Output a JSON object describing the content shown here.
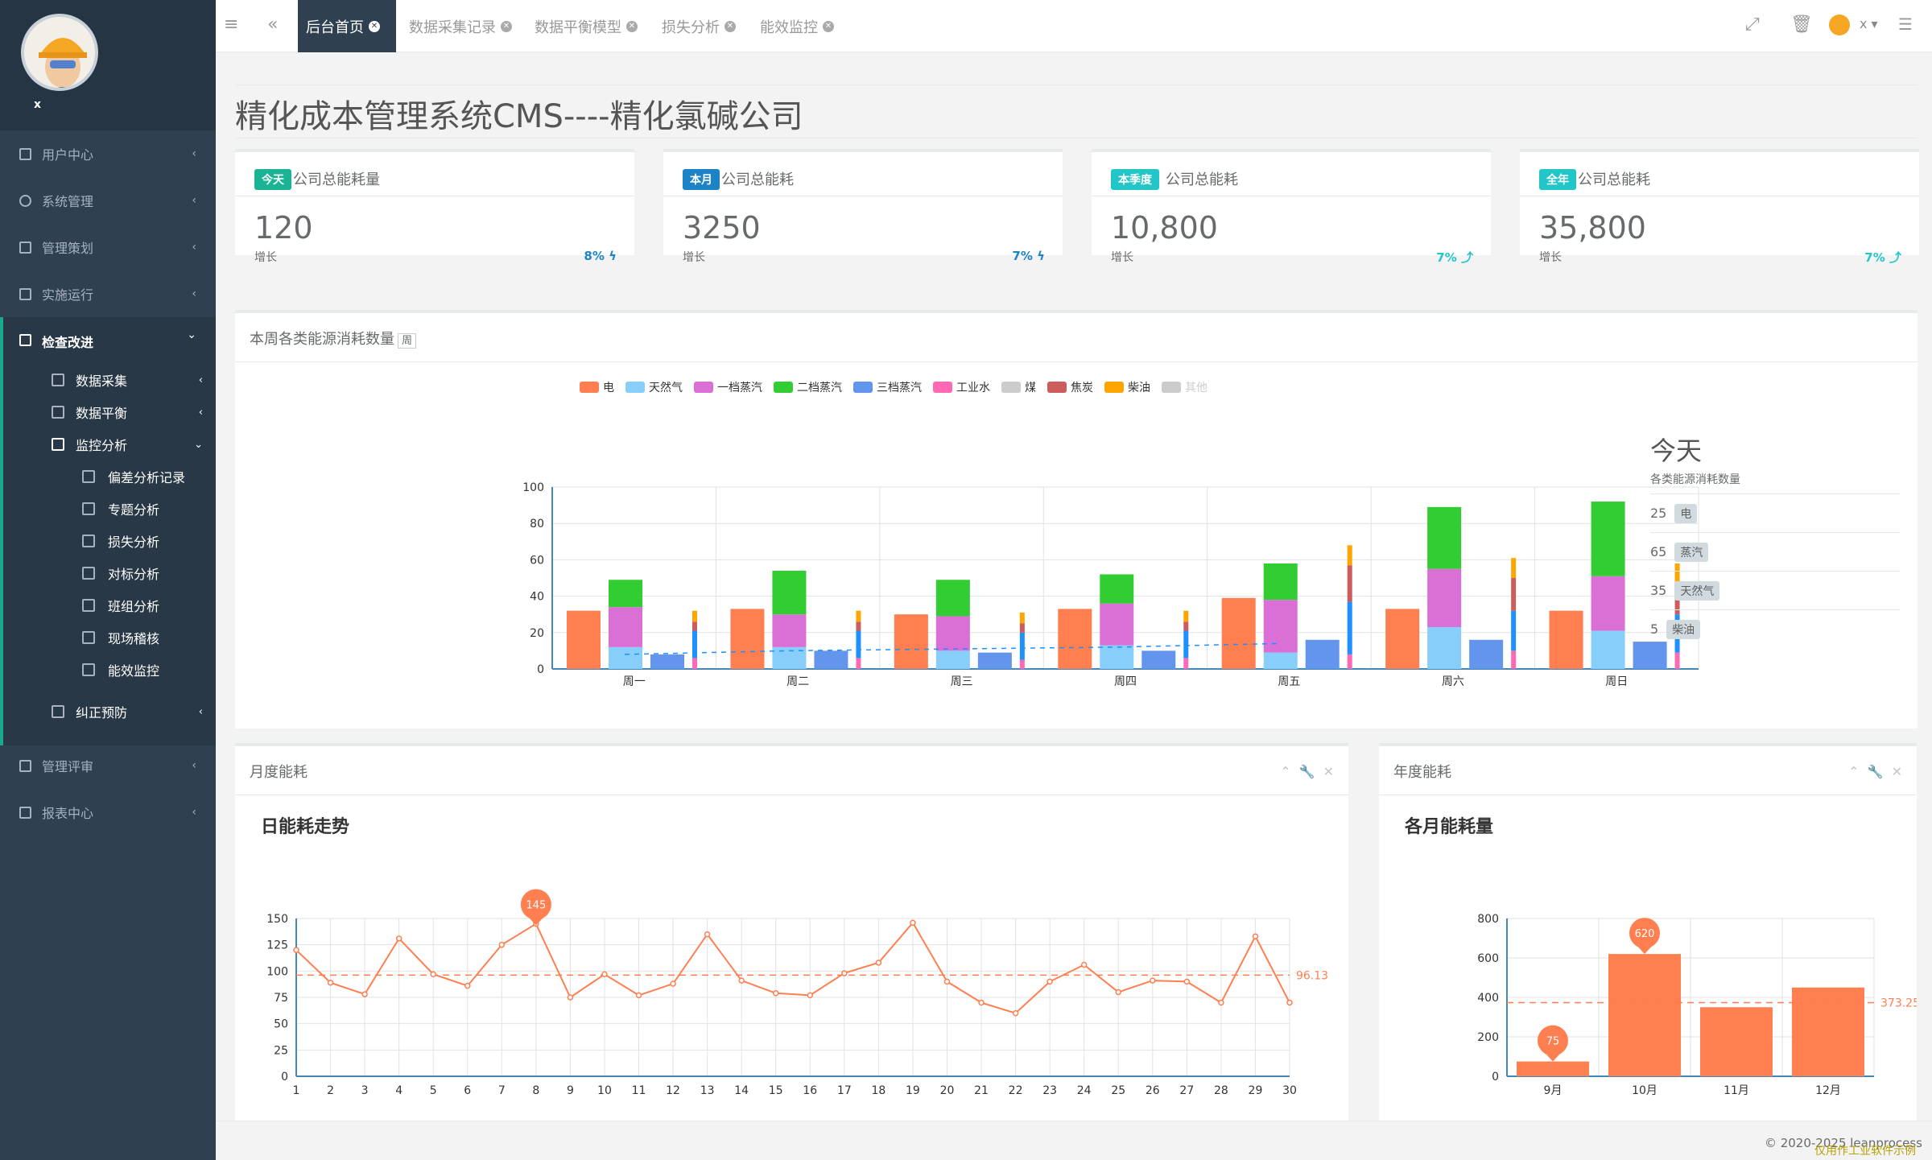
{
  "profile": {
    "name": "x"
  },
  "sidebar": {
    "items": [
      {
        "label": "用户中心",
        "arrow": "‹"
      },
      {
        "label": "系统管理",
        "arrow": "‹"
      },
      {
        "label": "管理策划",
        "arrow": "‹"
      },
      {
        "label": "实施运行",
        "arrow": "‹"
      },
      {
        "label": "检查改进",
        "arrow": "⌄"
      },
      {
        "label": "管理评审",
        "arrow": "‹"
      },
      {
        "label": "报表中心",
        "arrow": "‹"
      }
    ],
    "sub": [
      {
        "label": "数据采集",
        "arrow": "‹"
      },
      {
        "label": "数据平衡",
        "arrow": "‹"
      },
      {
        "label": "监控分析",
        "arrow": "⌄"
      },
      {
        "label": "纠正预防",
        "arrow": "‹"
      }
    ],
    "subsub": [
      "偏差分析记录",
      "专题分析",
      "损失分析",
      "对标分析",
      "班组分析",
      "现场稽核",
      "能效监控"
    ]
  },
  "topbar": {
    "tabs": [
      {
        "label": "后台首页",
        "active": true
      },
      {
        "label": "数据采集记录"
      },
      {
        "label": "数据平衡模型"
      },
      {
        "label": "损失分析"
      },
      {
        "label": "能效监控"
      }
    ],
    "user": "x"
  },
  "page": {
    "title": "精化成本管理系统CMS----精化氯碱公司"
  },
  "stats": [
    {
      "badge": "今天",
      "badge_color": "#1ab394",
      "title": "公司总能耗量",
      "value": "120",
      "label": "增长",
      "pct": "8% ϟ",
      "pct_color": "#1c84c6"
    },
    {
      "badge": "本月",
      "badge_color": "#1c84c6",
      "title": "公司总能耗",
      "value": "3250",
      "label": "增长",
      "pct": "7% ϟ",
      "pct_color": "#1c84c6"
    },
    {
      "badge": "本季度",
      "badge_color": "#23c6c8",
      "title": "公司总能耗",
      "value": "10,800",
      "label": "增长",
      "pct": "7% ⤴",
      "pct_color": "#23c6c8"
    },
    {
      "badge": "全年",
      "badge_color": "#23c6c8",
      "title": "公司总能耗",
      "value": "35,800",
      "label": "增长",
      "pct": "7% ⤴",
      "pct_color": "#23c6c8"
    }
  ],
  "weekly": {
    "header": "本周各类能源消耗数量",
    "header_tag": "周",
    "today_title": "今天",
    "today_sub": "各类能源消耗数量",
    "today_rows": [
      {
        "value": "25",
        "tag": "电"
      },
      {
        "value": "65",
        "tag": "蒸汽"
      },
      {
        "value": "35",
        "tag": "天然气"
      },
      {
        "value": "5",
        "tag": "柴油"
      }
    ]
  },
  "monthly_panel": {
    "header": "月度能耗",
    "chart_title": "日能耗走势"
  },
  "yearly_panel": {
    "header": "年度能耗",
    "chart_title": "各月能耗量"
  },
  "footer": {
    "copyright": "© 2020-2025 leanprocess",
    "watermark": "仅用作工业软件示例"
  },
  "colors": {
    "dark": "#2f4050",
    "accent": "#1ab394",
    "orange": "#ff7f50"
  },
  "chart_data": [
    {
      "type": "bar",
      "categories": [
        "周一",
        "周二",
        "周三",
        "周四",
        "周五",
        "周六",
        "周日"
      ],
      "ylim": [
        0,
        100
      ],
      "yticks": [
        0,
        20,
        40,
        60,
        80,
        100
      ],
      "legend": [
        {
          "name": "电",
          "color": "#ff7f50"
        },
        {
          "name": "天然气",
          "color": "#87cefa"
        },
        {
          "name": "一档蒸汽",
          "color": "#da70d6"
        },
        {
          "name": "二档蒸汽",
          "color": "#32cd32"
        },
        {
          "name": "三档蒸汽",
          "color": "#6495ed"
        },
        {
          "name": "工业水",
          "color": "#ff69b4"
        },
        {
          "name": "煤",
          "color": "#cccccc"
        },
        {
          "name": "焦炭",
          "color": "#cd5c5c"
        },
        {
          "name": "柴油",
          "color": "#ffa500"
        },
        {
          "name": "其他",
          "color": "#cccccc",
          "disabled": true
        }
      ],
      "series": [
        {
          "name": "电",
          "color": "#ff7f50",
          "values": [
            32,
            33,
            30,
            33,
            39,
            33,
            32
          ]
        },
        {
          "name": "天然气",
          "color": "#87cefa",
          "values": [
            12,
            12,
            10,
            13,
            9,
            23,
            21
          ]
        },
        {
          "name": "一档蒸汽",
          "color": "#da70d6",
          "values": [
            22,
            18,
            19,
            23,
            29,
            32,
            30
          ]
        },
        {
          "name": "二档蒸汽",
          "color": "#32cd32",
          "values": [
            15,
            24,
            20,
            16,
            20,
            34,
            41
          ]
        },
        {
          "name": "三档蒸汽",
          "color": "#6495ed",
          "values": [
            8,
            10,
            9,
            10,
            16,
            16,
            15
          ]
        },
        {
          "name": "工业水",
          "color": "#ff69b4",
          "values": [
            6,
            6,
            5,
            6,
            8,
            10,
            9
          ]
        },
        {
          "name": "焦炭",
          "color": "#cd5c5c",
          "values": [
            6,
            5,
            5,
            5,
            15,
            10,
            10
          ]
        },
        {
          "name": "柴油",
          "color": "#ffa500",
          "values": [
            6,
            6,
            6,
            6,
            11,
            11,
            12
          ]
        }
      ],
      "thin_bar": {
        "blue": [
          15,
          15,
          15,
          15,
          29,
          22,
          21
        ],
        "red": [
          5,
          5,
          5,
          5,
          20,
          18,
          16
        ],
        "pink": [
          6,
          6,
          6,
          6,
          8,
          10,
          9
        ]
      },
      "trend": [
        8,
        10,
        11,
        12,
        14,
        16,
        0
      ]
    },
    {
      "type": "line",
      "title": "日能耗走势",
      "x": [
        1,
        2,
        3,
        4,
        5,
        6,
        7,
        8,
        9,
        10,
        11,
        12,
        13,
        14,
        15,
        16,
        17,
        18,
        19,
        20,
        21,
        22,
        23,
        24,
        25,
        26,
        27,
        28,
        29,
        30
      ],
      "values": [
        120,
        89,
        78,
        131,
        97,
        86,
        125,
        145,
        75,
        97,
        77,
        88,
        135,
        91,
        79,
        77,
        98,
        108,
        146,
        90,
        70,
        60,
        90,
        106,
        80,
        91,
        90,
        70,
        133,
        70
      ],
      "ylim": [
        0,
        150
      ],
      "yticks": [
        0,
        25,
        50,
        75,
        100,
        125,
        150
      ],
      "max_label": "145",
      "avg_label": "96.13",
      "avg": 96.13,
      "color": "#ff7f50"
    },
    {
      "type": "bar",
      "title": "各月能耗量",
      "categories": [
        "9月",
        "10月",
        "11月",
        "12月"
      ],
      "values": [
        75,
        620,
        350,
        450
      ],
      "ylim": [
        0,
        800
      ],
      "yticks": [
        0,
        200,
        400,
        600,
        800
      ],
      "min_label": "75",
      "max_label": "620",
      "avg_label": "373.25",
      "avg": 373.25,
      "color": "#ff7f50"
    }
  ]
}
